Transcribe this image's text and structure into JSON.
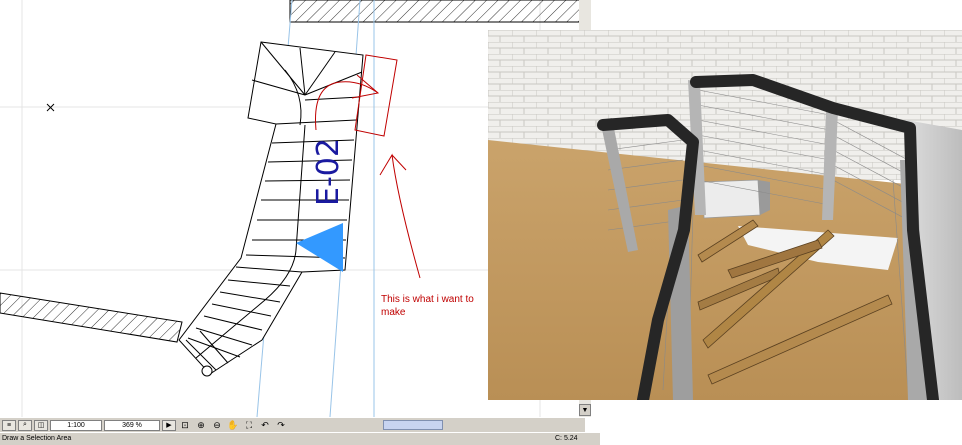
{
  "plan": {
    "stair_id": "E-02",
    "note_line1": "This is what i want to",
    "note_line2": "make"
  },
  "toolbar": {
    "scale": "1:100",
    "zoom": "369 %"
  },
  "status": {
    "message": "Draw a Selection Area",
    "coords": "C: 5.24"
  },
  "colors": {
    "annotation_red": "#c00000",
    "stair_tag_blue": "#1a1aa0",
    "arrow_blue": "#3399ff",
    "guide_line": "#99c4e8"
  }
}
